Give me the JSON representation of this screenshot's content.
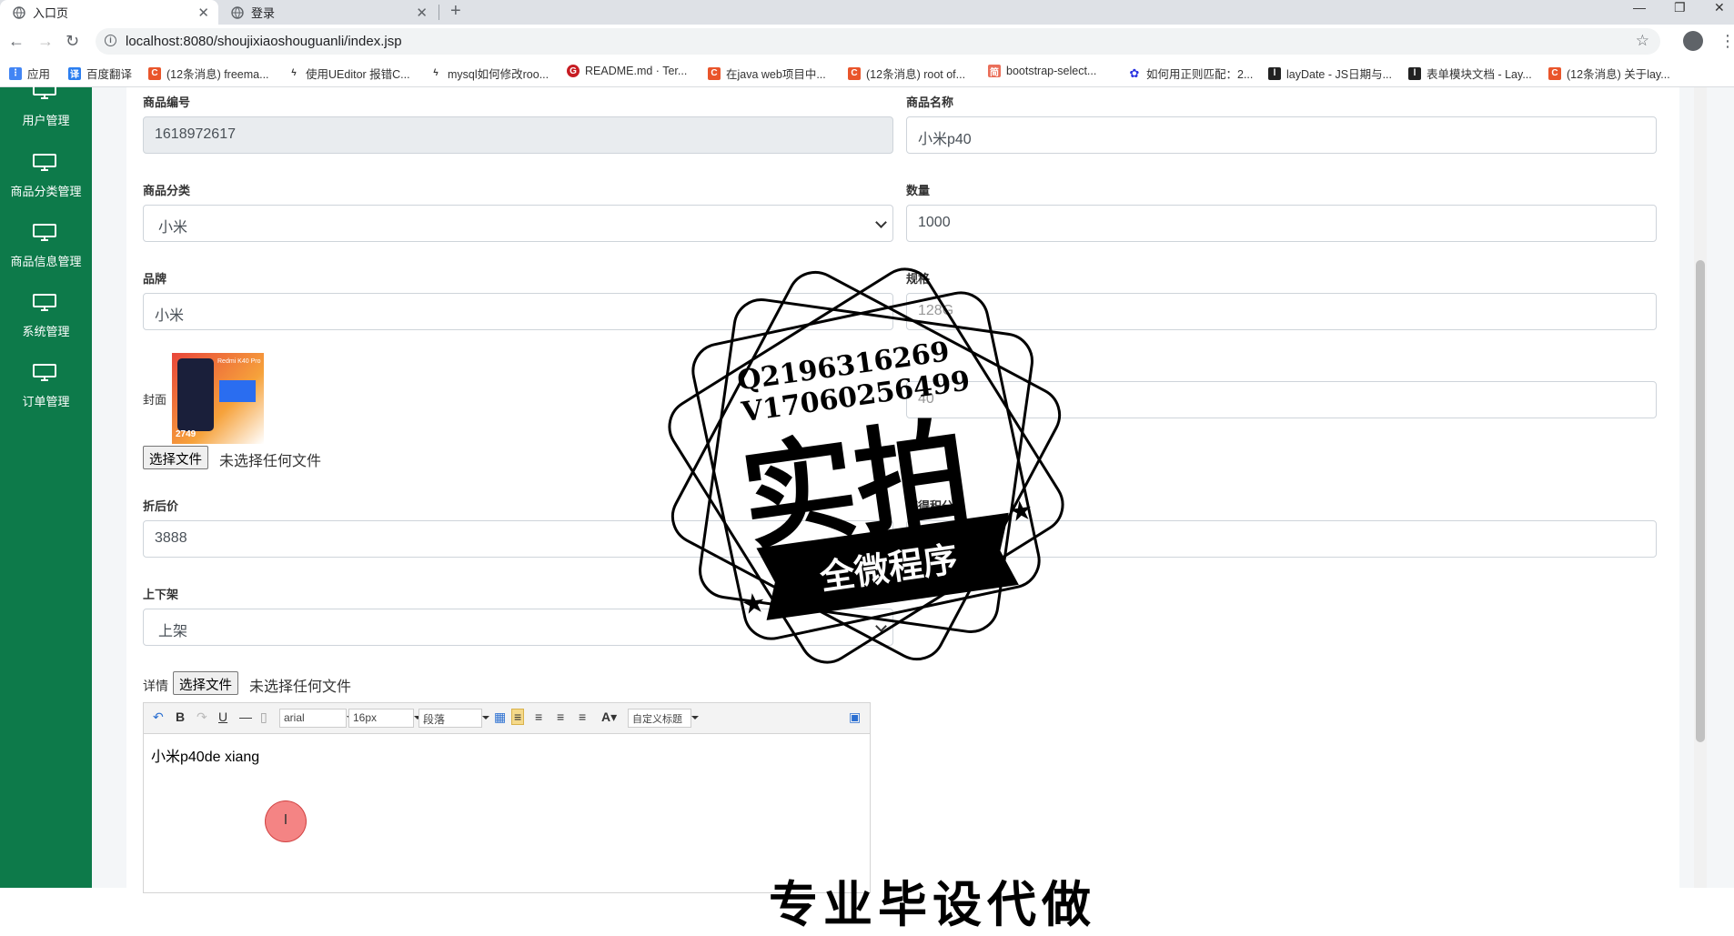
{
  "browser": {
    "tabs": [
      {
        "label": "入口页",
        "active": true
      },
      {
        "label": "登录",
        "active": false
      }
    ],
    "url": "localhost:8080/shoujixiaoshouguanli/index.jsp",
    "bookmarks": [
      {
        "label": "应用",
        "icon": "apps-grid-icon",
        "color": "#4285f4"
      },
      {
        "label": "百度翻译",
        "icon": "baidu-translate-icon",
        "color": "#2b7ef0"
      },
      {
        "label": "(12条消息) freema...",
        "icon": "csdn-icon",
        "color": "#e9552b"
      },
      {
        "label": "使用UEditor 报错C...",
        "icon": "leaf-icon",
        "color": "#333333"
      },
      {
        "label": "mysql如何修改roo...",
        "icon": "leaf-icon",
        "color": "#333333"
      },
      {
        "label": "README.md · Ter...",
        "icon": "gitee-icon",
        "color": "#c71d23"
      },
      {
        "label": "在java web项目中...",
        "icon": "csdn-icon",
        "color": "#e9552b"
      },
      {
        "label": "(12条消息) root of...",
        "icon": "csdn-icon",
        "color": "#e9552b"
      },
      {
        "label": "bootstrap-select...",
        "icon": "jianshu-icon",
        "color": "#ea6f5a"
      },
      {
        "label": "如何用正则匹配：2...",
        "icon": "baidu-paw-icon",
        "color": "#2932e1"
      },
      {
        "label": "layDate - JS日期与...",
        "icon": "layui-icon",
        "color": "#222222"
      },
      {
        "label": "表单模块文档 - Lay...",
        "icon": "layui-icon",
        "color": "#222222"
      },
      {
        "label": "(12条消息) 关于lay...",
        "icon": "csdn-icon",
        "color": "#e9552b"
      }
    ]
  },
  "sidebar": {
    "items": [
      {
        "label": "用户管理"
      },
      {
        "label": "商品分类管理"
      },
      {
        "label": "商品信息管理"
      },
      {
        "label": "系统管理"
      },
      {
        "label": "订单管理"
      }
    ]
  },
  "form": {
    "product_id": {
      "label": "商品编号",
      "value": "1618972617"
    },
    "product_name": {
      "label": "商品名称",
      "value": "小米p40"
    },
    "category": {
      "label": "商品分类",
      "value": "小米"
    },
    "quantity": {
      "label": "数量",
      "value": "1000"
    },
    "brand": {
      "label": "品牌",
      "value": "小米"
    },
    "spec": {
      "label": "规格",
      "value": "128G"
    },
    "cover": {
      "label": "封面",
      "file_button": "选择文件",
      "file_status": "未选择任何文件"
    },
    "partial_value": {
      "value": "40"
    },
    "discount_price": {
      "label": "折后价",
      "value": "3888"
    },
    "points_label": "可得积分",
    "listing": {
      "label": "上下架",
      "value": "上架"
    },
    "detail": {
      "label": "详情",
      "file_button": "选择文件",
      "file_status": "未选择任何文件"
    }
  },
  "editor": {
    "font_family": "arial",
    "font_size": "16px",
    "paragraph": "段落",
    "custom_heading": "自定义标题",
    "content": "小米p40de xiang",
    "cursor_glyph": "I"
  },
  "cover_thumb": {
    "brand_line": "Redmi K40 Pro",
    "price": "2749"
  },
  "watermark": {
    "line1": "Q2196316269",
    "line2": "V17060256499",
    "big": "实拍",
    "ribbon": "全微程序",
    "bottom": "专业毕设代做"
  },
  "colors": {
    "sidebar": "#0d7a4a",
    "accent": "#4285f4"
  }
}
